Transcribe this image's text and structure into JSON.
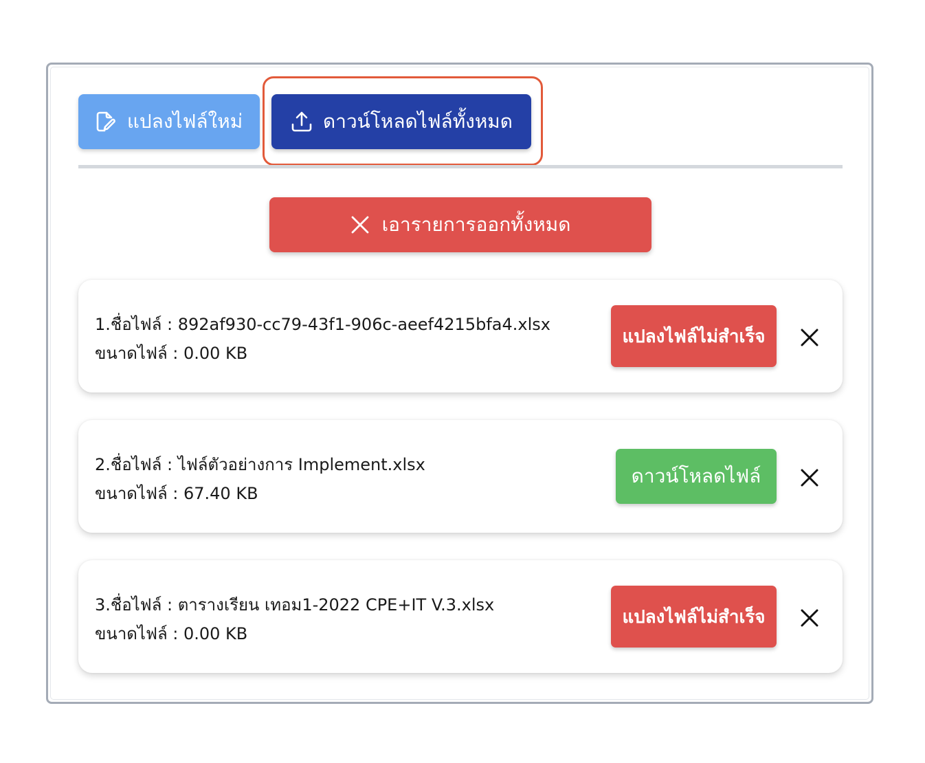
{
  "toolbar": {
    "new_file_label": "แปลงไฟล์ใหม่",
    "download_all_label": "ดาวน์โหลดไฟล์ทั้งหมด",
    "clear_all_label": "เอารายการออกทั้งหมด"
  },
  "files": [
    {
      "name_line": "1.ชื่อไฟล์ : 892af930-cc79-43f1-906c-aeef4215bfa4.xlsx",
      "size_line": "ขนาดไฟล์ : 0.00 KB",
      "status_label": "แปลงไฟล์ไม่สำเร็จ",
      "status": "failed"
    },
    {
      "name_line": "2.ชื่อไฟล์ : ไฟล์ตัวอย่างการ Implement.xlsx",
      "size_line": "ขนาดไฟล์ : 67.40 KB",
      "status_label": "ดาวน์โหลดไฟล์",
      "status": "success"
    },
    {
      "name_line": "3.ชื่อไฟล์ : ตารางเรียน เทอม1-2022 CPE+IT V.3.xlsx",
      "size_line": "ขนาดไฟล์ : 0.00 KB",
      "status_label": "แปลงไฟล์ไม่สำเร็จ",
      "status": "failed"
    }
  ],
  "colors": {
    "new_file_button": "#68a5f0",
    "download_all_button": "#2440a6",
    "clear_button": "#df514d",
    "failed_status": "#df514d",
    "success_status": "#5dbe64",
    "highlight_ring": "#e25a3a"
  },
  "icons": {
    "new_file": "edit-file-icon",
    "download_all": "upload-icon",
    "clear_all": "close-icon",
    "remove_item": "close-icon"
  }
}
